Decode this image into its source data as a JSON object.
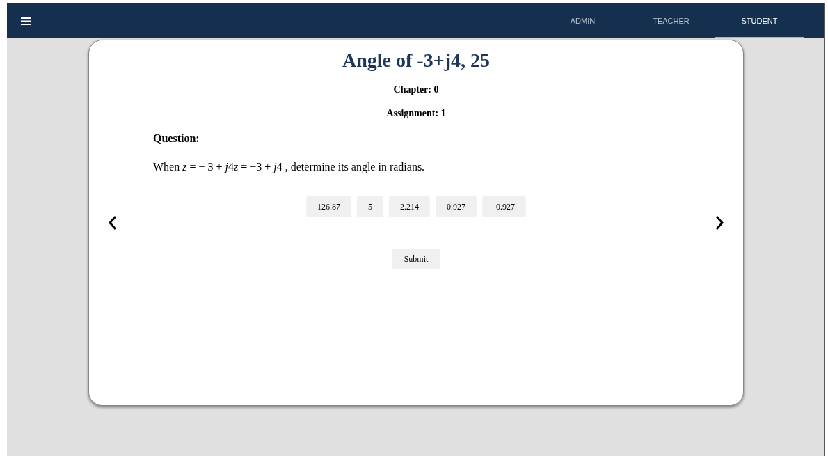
{
  "nav": {
    "tabs": [
      {
        "label": "ADMIN",
        "selected": false
      },
      {
        "label": "TEACHER",
        "selected": false
      },
      {
        "label": "STUDENT",
        "selected": true
      }
    ]
  },
  "card": {
    "title": "Angle of -3+j4, 25",
    "chapter": "Chapter: 0",
    "assignment": "Assignment: 1",
    "question_label": "Question:",
    "question": [
      {
        "text": "When ",
        "italic": false
      },
      {
        "text": "z",
        "italic": true
      },
      {
        "text": " = − 3 + ",
        "italic": false
      },
      {
        "text": "j",
        "italic": true
      },
      {
        "text": "4",
        "italic": false
      },
      {
        "text": "z",
        "italic": true
      },
      {
        "text": " = −3 + ",
        "italic": false
      },
      {
        "text": "j",
        "italic": true
      },
      {
        "text": "4 , determine its angle in radians.",
        "italic": false
      }
    ],
    "options": [
      "126.87",
      "5",
      "2.214",
      "0.927",
      "-0.927"
    ],
    "submit": "Submit"
  }
}
